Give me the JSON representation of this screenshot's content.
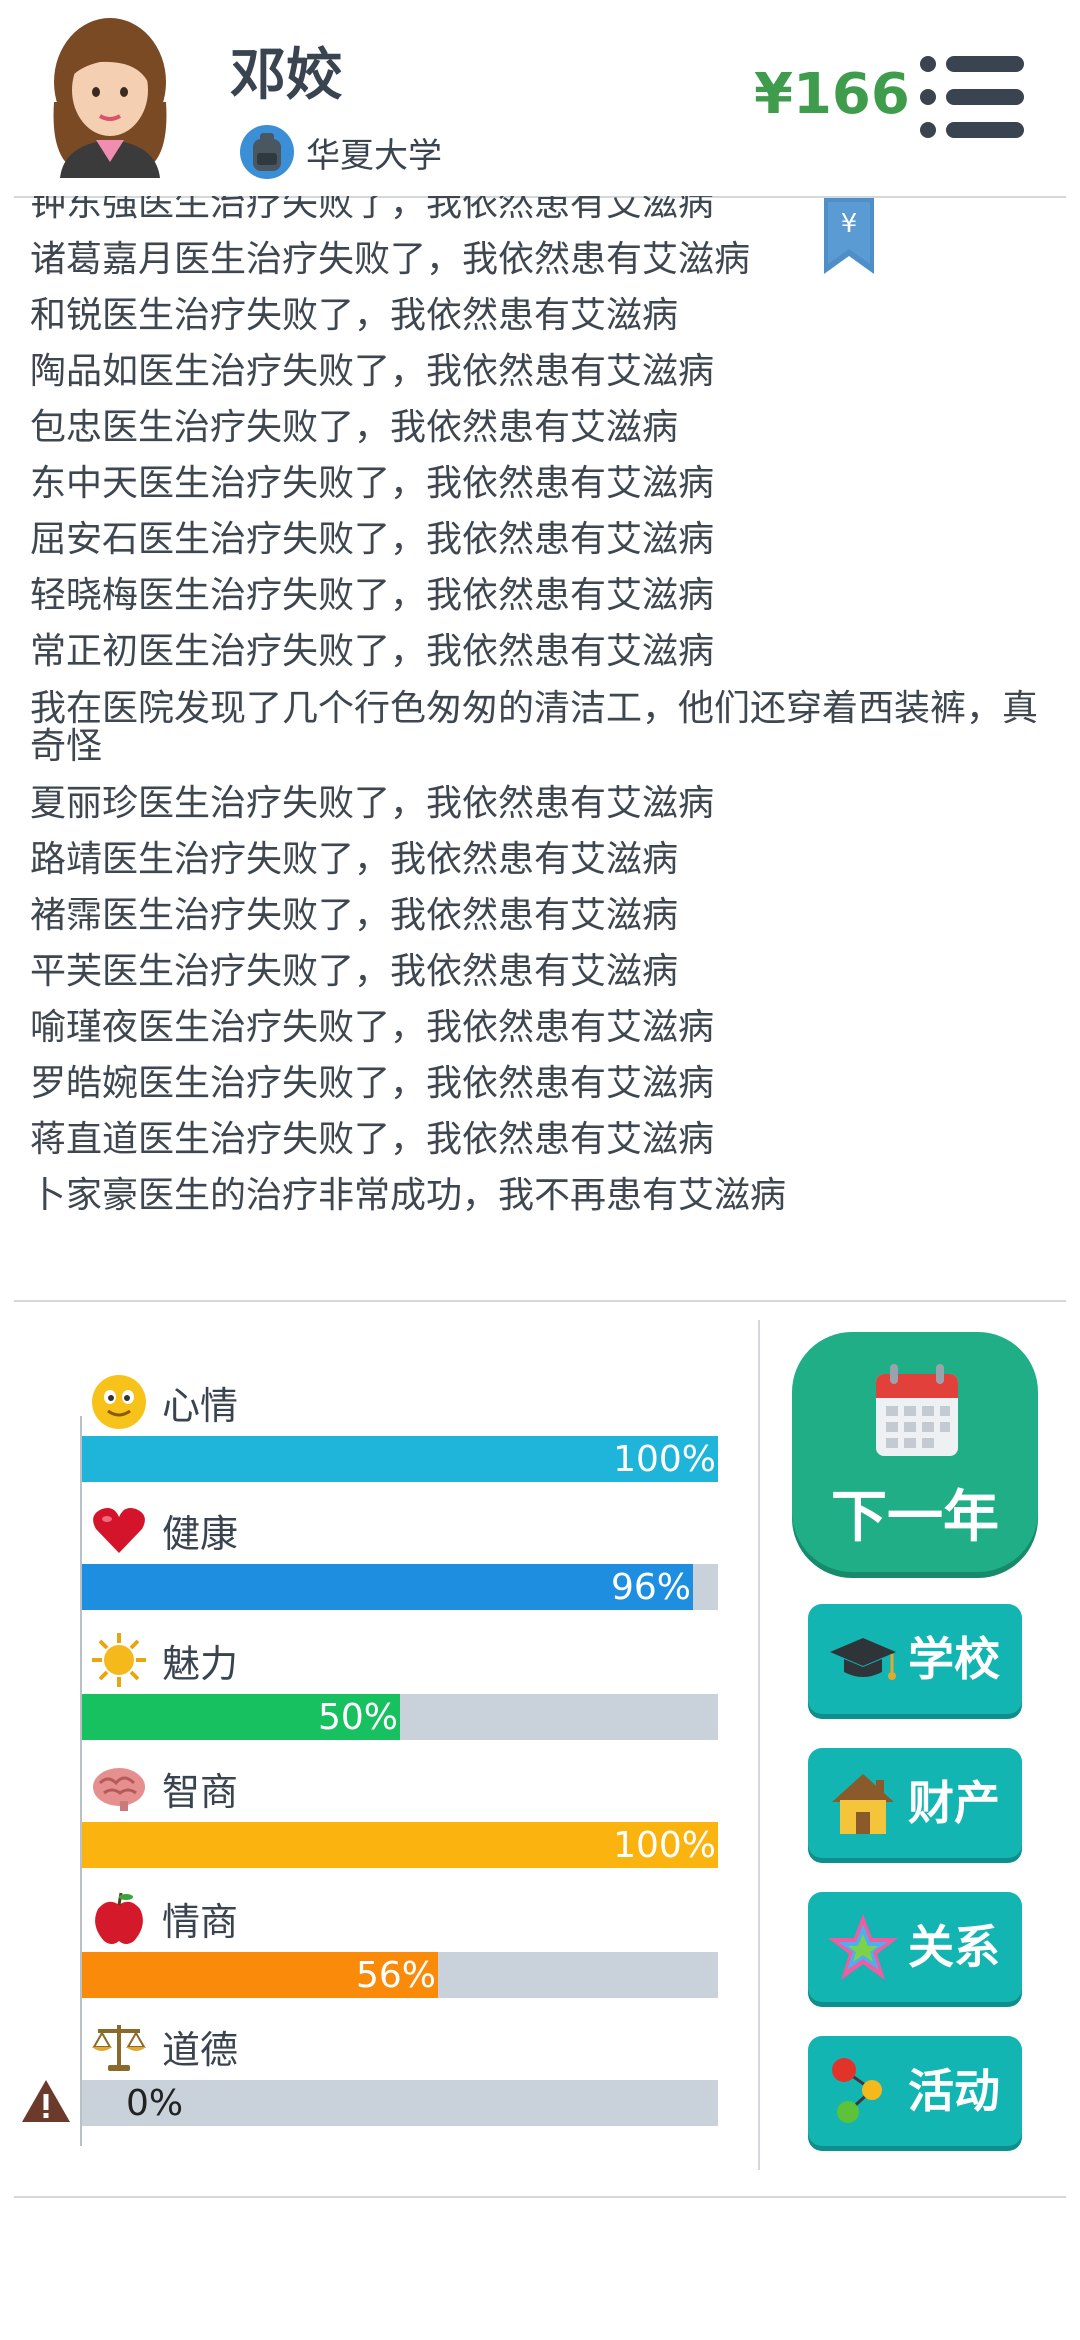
{
  "header": {
    "name": "邓姣",
    "school": "华夏大学",
    "money": "¥166",
    "menu_icon": "menu-icon"
  },
  "bookmark": {
    "symbol": "¥"
  },
  "log": [
    "钟东强医生治疗失败了，我依然患有艾滋病",
    "诸葛嘉月医生治疗失败了，我依然患有艾滋病",
    "和锐医生治疗失败了，我依然患有艾滋病",
    "陶品如医生治疗失败了，我依然患有艾滋病",
    "包忠医生治疗失败了，我依然患有艾滋病",
    "东中天医生治疗失败了，我依然患有艾滋病",
    "屈安石医生治疗失败了，我依然患有艾滋病",
    "轻晓梅医生治疗失败了，我依然患有艾滋病",
    "常正初医生治疗失败了，我依然患有艾滋病",
    "我在医院发现了几个行色匆匆的清洁工，他们还穿着西装裤，真奇怪",
    "夏丽珍医生治疗失败了，我依然患有艾滋病",
    "路靖医生治疗失败了，我依然患有艾滋病",
    "褚霈医生治疗失败了，我依然患有艾滋病",
    "平芙医生治疗失败了，我依然患有艾滋病",
    "喻瑾夜医生治疗失败了，我依然患有艾滋病",
    "罗皓婉医生治疗失败了，我依然患有艾滋病",
    "蒋直道医生治疗失败了，我依然患有艾滋病",
    "卜家豪医生的治疗非常成功，我不再患有艾滋病"
  ],
  "stats": [
    {
      "label": "心情",
      "value": 100,
      "display": "100%",
      "color": "#1fb5db",
      "icon": "smiley-icon"
    },
    {
      "label": "健康",
      "value": 96,
      "display": "96%",
      "color": "#1e8fe0",
      "icon": "heart-icon"
    },
    {
      "label": "魅力",
      "value": 50,
      "display": "50%",
      "color": "#17c160",
      "icon": "sun-icon"
    },
    {
      "label": "智商",
      "value": 100,
      "display": "100%",
      "color": "#fbb40f",
      "icon": "brain-icon"
    },
    {
      "label": "情商",
      "value": 56,
      "display": "56%",
      "color": "#f98a0a",
      "icon": "apple-icon"
    },
    {
      "label": "道德",
      "value": 0,
      "display": "0%",
      "color": "#c9d2da",
      "icon": "scales-icon"
    }
  ],
  "buttons": {
    "next_year": "下一年",
    "school": "学校",
    "property": "财产",
    "relations": "关系",
    "activities": "活动"
  },
  "colors": {
    "money": "#3f9c4c",
    "next_year_bg": "#1fae86",
    "side_btn_bg": "#13b5b3",
    "track": "#c9d2da"
  }
}
